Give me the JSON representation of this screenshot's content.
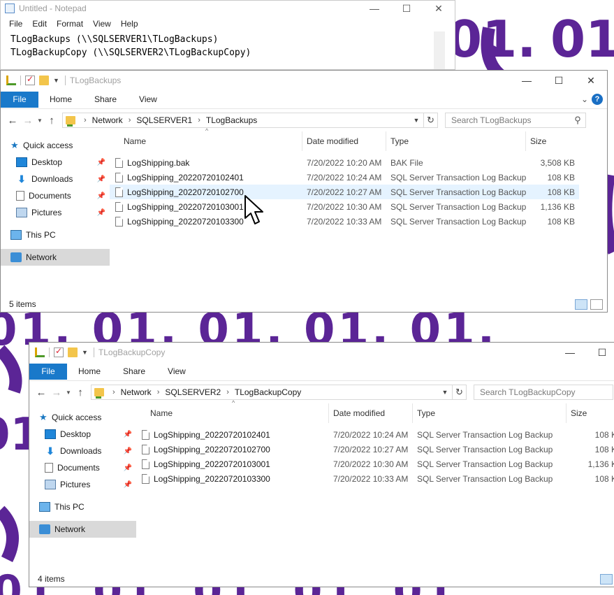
{
  "notepad": {
    "title": "Untitled - Notepad",
    "menu": [
      "File",
      "Edit",
      "Format",
      "View",
      "Help"
    ],
    "lines": [
      "TLogBackups (\\\\SQLSERVER1\\TLogBackups)",
      "TLogBackupCopy (\\\\SQLSERVER2\\TLogBackupCopy)"
    ],
    "controls": {
      "minimize": "—",
      "maximize": "☐",
      "close": "✕"
    }
  },
  "background": {
    "numeral_1": "01",
    "numeral_2": "01."
  },
  "window1": {
    "title": "TLogBackups",
    "ribbon_tabs": [
      "File",
      "Home",
      "Share",
      "View"
    ],
    "breadcrumbs": [
      "Network",
      "SQLSERVER1",
      "TLogBackups"
    ],
    "search_placeholder": "Search TLogBackups",
    "columns": {
      "name": "Name",
      "date": "Date modified",
      "type": "Type",
      "size": "Size"
    },
    "nav": {
      "quick_access": "Quick access",
      "desktop": "Desktop",
      "downloads": "Downloads",
      "documents": "Documents",
      "pictures": "Pictures",
      "this_pc": "This PC",
      "network": "Network"
    },
    "files": [
      {
        "name": "LogShipping.bak",
        "date": "7/20/2022 10:20 AM",
        "type": "BAK File",
        "size": "3,508 KB"
      },
      {
        "name": "LogShipping_20220720102401",
        "date": "7/20/2022 10:24 AM",
        "type": "SQL Server Transaction Log Backup",
        "size": "108 KB"
      },
      {
        "name": "LogShipping_20220720102700",
        "date": "7/20/2022 10:27 AM",
        "type": "SQL Server Transaction Log Backup",
        "size": "108 KB"
      },
      {
        "name": "LogShipping_20220720103001",
        "date": "7/20/2022 10:30 AM",
        "type": "SQL Server Transaction Log Backup",
        "size": "1,136 KB"
      },
      {
        "name": "LogShipping_20220720103300",
        "date": "7/20/2022 10:33 AM",
        "type": "SQL Server Transaction Log Backup",
        "size": "108 KB"
      }
    ],
    "status": "5 items"
  },
  "window2": {
    "title": "TLogBackupCopy",
    "ribbon_tabs": [
      "File",
      "Home",
      "Share",
      "View"
    ],
    "breadcrumbs": [
      "Network",
      "SQLSERVER2",
      "TLogBackupCopy"
    ],
    "search_placeholder": "Search TLogBackupCopy",
    "columns": {
      "name": "Name",
      "date": "Date modified",
      "type": "Type",
      "size": "Size"
    },
    "nav": {
      "quick_access": "Quick access",
      "desktop": "Desktop",
      "downloads": "Downloads",
      "documents": "Documents",
      "pictures": "Pictures",
      "this_pc": "This PC",
      "network": "Network"
    },
    "files": [
      {
        "name": "LogShipping_20220720102401",
        "date": "7/20/2022 10:24 AM",
        "type": "SQL Server Transaction Log Backup",
        "size": "108 K"
      },
      {
        "name": "LogShipping_20220720102700",
        "date": "7/20/2022 10:27 AM",
        "type": "SQL Server Transaction Log Backup",
        "size": "108 K"
      },
      {
        "name": "LogShipping_20220720103001",
        "date": "7/20/2022 10:30 AM",
        "type": "SQL Server Transaction Log Backup",
        "size": "1,136 K"
      },
      {
        "name": "LogShipping_20220720103300",
        "date": "7/20/2022 10:33 AM",
        "type": "SQL Server Transaction Log Backup",
        "size": "108 K"
      }
    ],
    "status": "4 items"
  },
  "colors": {
    "accent": "#1979ca",
    "wallpaper": "#5b2596",
    "hover_row": "#e5f3ff"
  }
}
